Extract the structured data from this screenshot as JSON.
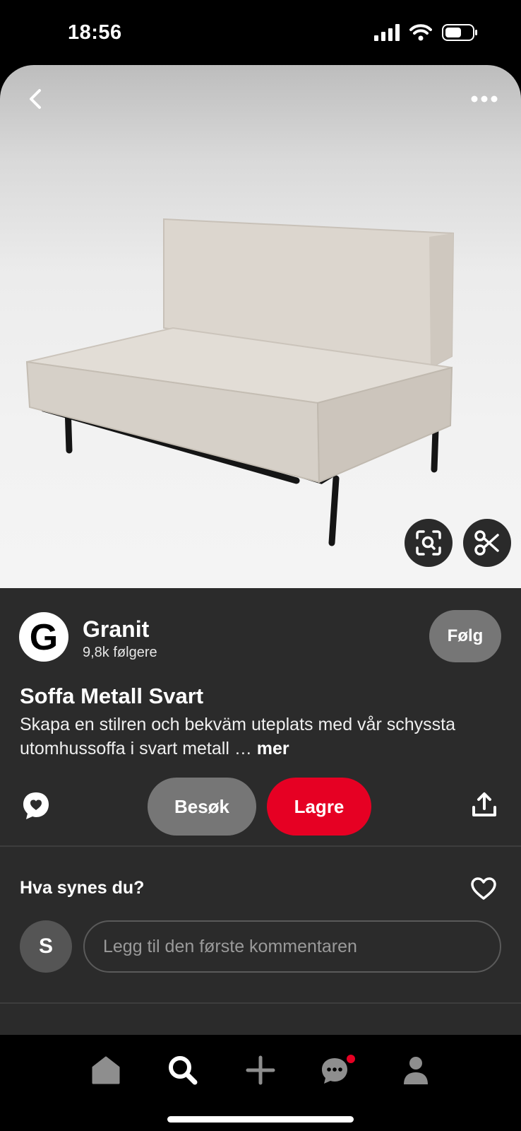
{
  "status_bar": {
    "time": "18:56"
  },
  "creator": {
    "logo_letter": "G",
    "name": "Granit",
    "followers": "9,8k følgere",
    "follow_label": "Følg"
  },
  "pin": {
    "title": "Soffa Metall Svart",
    "description": "Skapa en stilren och bekväm uteplats med vår schyssta utomhussoffa i svart metall …",
    "more_label": "mer"
  },
  "actions": {
    "visit_label": "Besøk",
    "save_label": "Lagre"
  },
  "comments": {
    "heading": "Hva synes du?",
    "user_initial": "S",
    "placeholder": "Legg til den første kommentaren"
  },
  "colors": {
    "accent": "#e60023",
    "panel": "#2b2b2b",
    "button_gray": "#767676"
  },
  "icons": [
    "back-icon",
    "more-options-icon",
    "visual-search-icon",
    "scissors-icon",
    "comment-icon",
    "share-icon",
    "heart-icon",
    "home-icon",
    "search-icon",
    "add-icon",
    "messages-icon",
    "profile-icon"
  ]
}
